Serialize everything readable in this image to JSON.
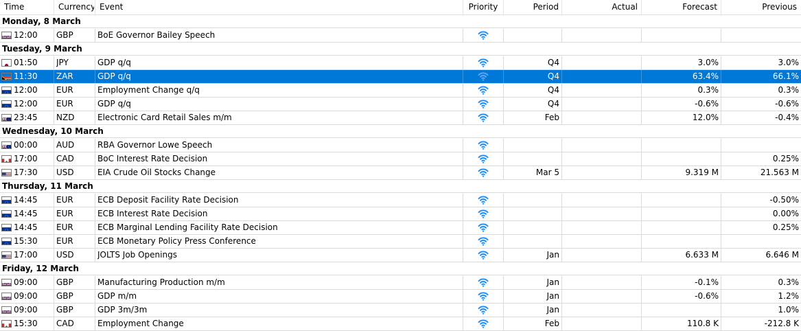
{
  "columns": {
    "time": "Time",
    "currency": "Currency",
    "event": "Event",
    "priority": "Priority",
    "period": "Period",
    "actual": "Actual",
    "forecast": "Forecast",
    "previous": "Previous"
  },
  "colors": {
    "selection": "#0078d7",
    "priority_icon": "#1e90ff",
    "priority_icon_selected": "#5aa8ee"
  },
  "groups": [
    {
      "day": "Monday, 8 March",
      "events": [
        {
          "flag": "gb-flag-icon",
          "time": "12:00",
          "currency": "GBP",
          "event": "BoE Governor Bailey Speech",
          "period": "",
          "actual": "",
          "forecast": "",
          "previous": "",
          "selected": false
        }
      ]
    },
    {
      "day": "Tuesday, 9 March",
      "events": [
        {
          "flag": "jp-flag-icon",
          "time": "01:50",
          "currency": "JPY",
          "event": "GDP q/q",
          "period": "Q4",
          "actual": "",
          "forecast": "3.0%",
          "previous": "3.0%",
          "selected": false
        },
        {
          "flag": "za-flag-icon",
          "time": "11:30",
          "currency": "ZAR",
          "event": "GDP q/q",
          "period": "Q4",
          "actual": "",
          "forecast": "63.4%",
          "previous": "66.1%",
          "selected": true
        },
        {
          "flag": "eu-flag-icon",
          "time": "12:00",
          "currency": "EUR",
          "event": "Employment Change q/q",
          "period": "Q4",
          "actual": "",
          "forecast": "0.3%",
          "previous": "0.3%",
          "selected": false
        },
        {
          "flag": "eu-flag-icon",
          "time": "12:00",
          "currency": "EUR",
          "event": "GDP q/q",
          "period": "Q4",
          "actual": "",
          "forecast": "-0.6%",
          "previous": "-0.6%",
          "selected": false
        },
        {
          "flag": "nz-flag-icon",
          "time": "23:45",
          "currency": "NZD",
          "event": "Electronic Card Retail Sales m/m",
          "period": "Feb",
          "actual": "",
          "forecast": "12.0%",
          "previous": "-0.4%",
          "selected": false
        }
      ]
    },
    {
      "day": "Wednesday, 10 March",
      "events": [
        {
          "flag": "au-flag-icon",
          "time": "00:00",
          "currency": "AUD",
          "event": "RBA Governor Lowe Speech",
          "period": "",
          "actual": "",
          "forecast": "",
          "previous": "",
          "selected": false
        },
        {
          "flag": "ca-flag-icon",
          "time": "17:00",
          "currency": "CAD",
          "event": "BoC Interest Rate Decision",
          "period": "",
          "actual": "",
          "forecast": "",
          "previous": "0.25%",
          "selected": false
        },
        {
          "flag": "us-flag-icon",
          "time": "17:30",
          "currency": "USD",
          "event": "EIA Crude Oil Stocks Change",
          "period": "Mar 5",
          "actual": "",
          "forecast": "9.319 M",
          "previous": "21.563 M",
          "selected": false
        }
      ]
    },
    {
      "day": "Thursday, 11 March",
      "events": [
        {
          "flag": "eu-flag-icon",
          "time": "14:45",
          "currency": "EUR",
          "event": "ECB Deposit Facility Rate Decision",
          "period": "",
          "actual": "",
          "forecast": "",
          "previous": "-0.50%",
          "selected": false
        },
        {
          "flag": "eu-flag-icon",
          "time": "14:45",
          "currency": "EUR",
          "event": "ECB Interest Rate Decision",
          "period": "",
          "actual": "",
          "forecast": "",
          "previous": "0.00%",
          "selected": false
        },
        {
          "flag": "eu-flag-icon",
          "time": "14:45",
          "currency": "EUR",
          "event": "ECB Marginal Lending Facility Rate Decision",
          "period": "",
          "actual": "",
          "forecast": "",
          "previous": "0.25%",
          "selected": false
        },
        {
          "flag": "eu-flag-icon",
          "time": "15:30",
          "currency": "EUR",
          "event": "ECB Monetary Policy Press Conference",
          "period": "",
          "actual": "",
          "forecast": "",
          "previous": "",
          "selected": false
        },
        {
          "flag": "us-flag-icon",
          "time": "17:00",
          "currency": "USD",
          "event": "JOLTS Job Openings",
          "period": "Jan",
          "actual": "",
          "forecast": "6.633 M",
          "previous": "6.646 M",
          "selected": false
        }
      ]
    },
    {
      "day": "Friday, 12 March",
      "events": [
        {
          "flag": "gb-flag-icon",
          "time": "09:00",
          "currency": "GBP",
          "event": "Manufacturing Production m/m",
          "period": "Jan",
          "actual": "",
          "forecast": "-0.1%",
          "previous": "0.3%",
          "selected": false
        },
        {
          "flag": "gb-flag-icon",
          "time": "09:00",
          "currency": "GBP",
          "event": "GDP m/m",
          "period": "Jan",
          "actual": "",
          "forecast": "-0.6%",
          "previous": "1.2%",
          "selected": false
        },
        {
          "flag": "gb-flag-icon",
          "time": "09:00",
          "currency": "GBP",
          "event": "GDP 3m/3m",
          "period": "Jan",
          "actual": "",
          "forecast": "",
          "previous": "1.0%",
          "selected": false
        },
        {
          "flag": "ca-flag-icon",
          "time": "15:30",
          "currency": "CAD",
          "event": "Employment Change",
          "period": "Feb",
          "actual": "",
          "forecast": "110.8 K",
          "previous": "-212.8 K",
          "selected": false
        }
      ]
    }
  ]
}
